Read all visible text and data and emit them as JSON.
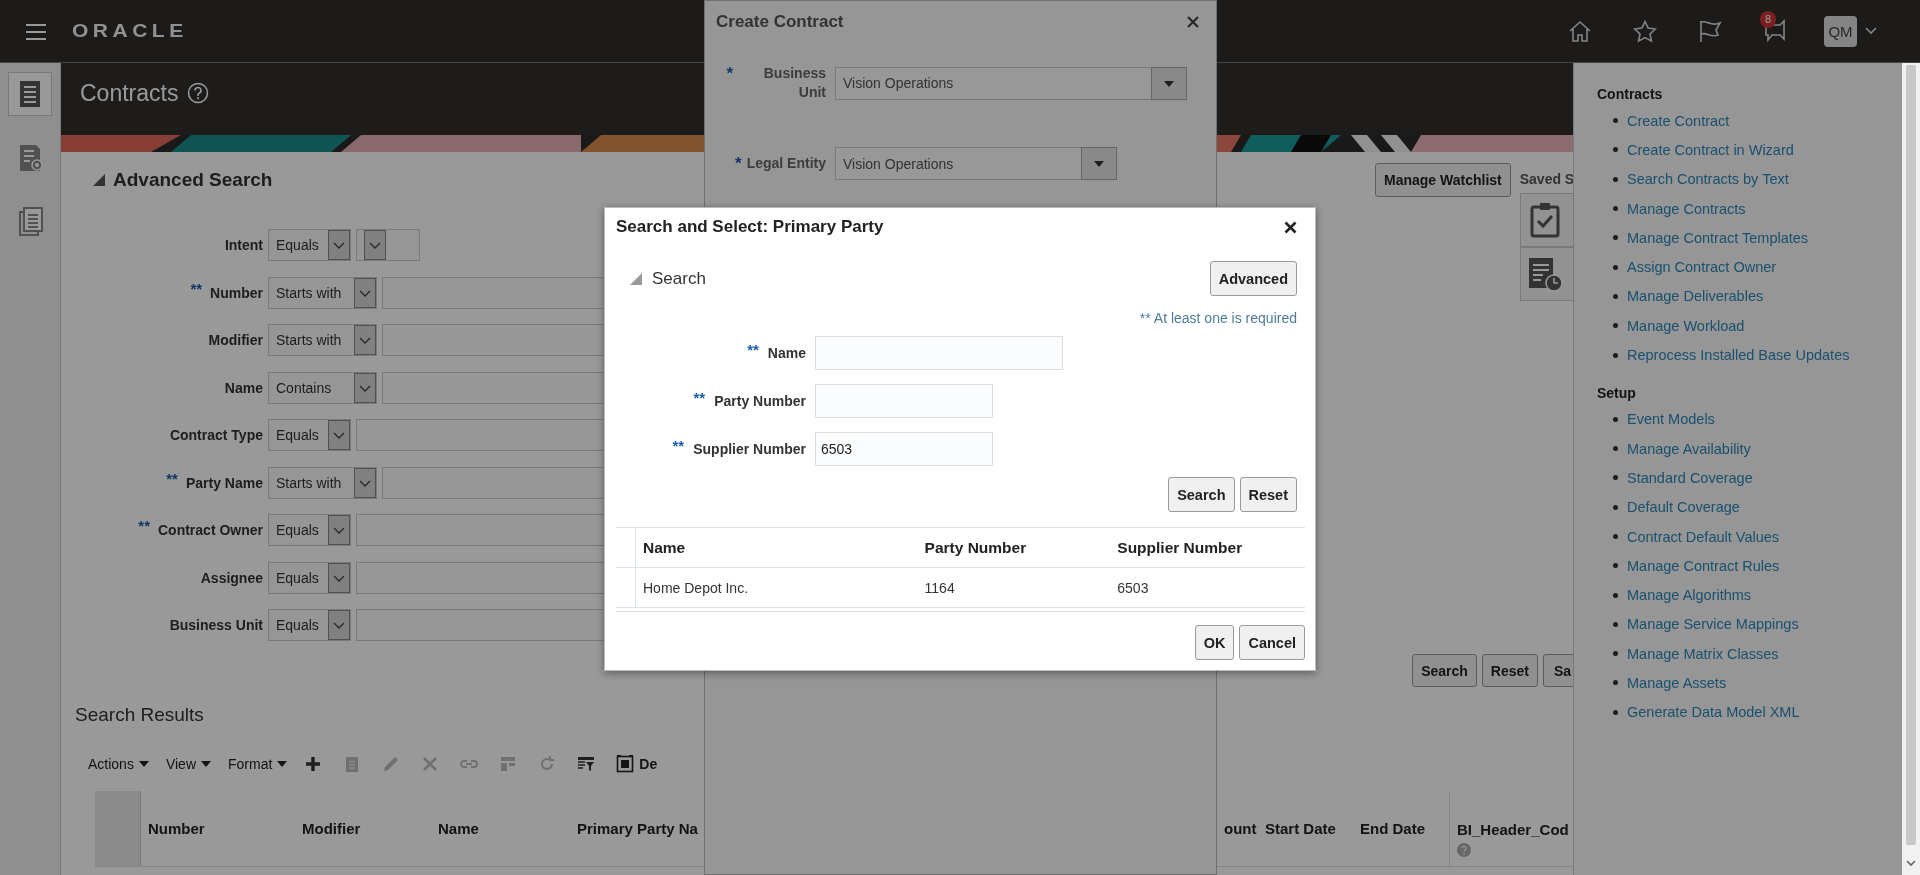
{
  "top_bar": {
    "logo": "ORACLE",
    "notification_count": "8",
    "avatar": "QM"
  },
  "left_nav": [
    {
      "kind": "list",
      "selected": true
    },
    {
      "kind": "search-document",
      "selected": false
    },
    {
      "kind": "document",
      "selected": false
    }
  ],
  "page_header": {
    "title": "Contracts"
  },
  "advanced_search": {
    "title": "Advanced Search",
    "manage_button": "Manage Watchlist",
    "saved_label": "Saved S",
    "fields": [
      {
        "label": "Intent",
        "operator": "Equals",
        "kind": "choice"
      },
      {
        "marker": "**",
        "label": "Number",
        "operator": "Starts with",
        "kind": "text"
      },
      {
        "label": "Modifier",
        "operator": "Starts with",
        "kind": "text"
      },
      {
        "label": "Name",
        "operator": "Contains",
        "kind": "text"
      },
      {
        "label": "Contract Type",
        "operator": "Equals",
        "kind": "text"
      },
      {
        "marker": "**",
        "label": "Party Name",
        "operator": "Starts with",
        "kind": "text"
      },
      {
        "marker": "**",
        "label": "Contract Owner",
        "operator": "Equals",
        "kind": "text"
      },
      {
        "label": "Assignee",
        "operator": "Equals",
        "kind": "text"
      },
      {
        "label": "Business Unit",
        "operator": "Equals",
        "kind": "text"
      }
    ],
    "buttons": [
      "Search",
      "Reset",
      "Sa"
    ]
  },
  "search_results": {
    "title": "Search Results",
    "menus": [
      "Actions",
      "View",
      "Format"
    ],
    "tools": [
      {
        "kind": "add",
        "disabled": false
      },
      {
        "kind": "duplicate",
        "disabled": true
      },
      {
        "kind": "edit",
        "disabled": true
      },
      {
        "kind": "delete",
        "disabled": true
      },
      {
        "kind": "link",
        "disabled": true
      },
      {
        "kind": "columns",
        "disabled": true
      },
      {
        "kind": "refresh",
        "disabled": true
      },
      {
        "kind": "freeze",
        "disabled": false
      },
      {
        "kind": "detach",
        "label": "De",
        "disabled": false
      }
    ],
    "columns": [
      {
        "label": "Number"
      },
      {
        "label": "Modifier"
      },
      {
        "label": "Name"
      },
      {
        "label": "Primary Party Na"
      },
      {
        "label": "ount"
      },
      {
        "label": "Start Date"
      },
      {
        "label": "End Date"
      },
      {
        "label": "BI_Header_Cod",
        "help": true
      }
    ]
  },
  "create_contract": {
    "title": "Create Contract",
    "fields": [
      {
        "marker": "*",
        "label": "Business Unit",
        "value": "Vision Operations"
      },
      {
        "marker": "*",
        "label": "Legal Entity",
        "value": "Vision Operations"
      }
    ]
  },
  "tasks_panel": {
    "sections": [
      {
        "title": "Contracts",
        "links": [
          "Create Contract",
          "Create Contract in Wizard",
          "Search Contracts by Text",
          "Manage Contracts",
          "Manage Contract Templates",
          "Assign Contract Owner",
          "Manage Deliverables",
          "Manage Workload",
          "Reprocess Installed Base Updates"
        ]
      },
      {
        "title": "Setup",
        "links": [
          "Event Models",
          "Manage Availability",
          "Standard Coverage",
          "Default Coverage",
          "Contract Default Values",
          "Manage Contract Rules",
          "Manage Algorithms",
          "Manage Service Mappings",
          "Manage Matrix Classes",
          "Manage Assets",
          "Generate Data Model XML"
        ]
      }
    ]
  },
  "dialog": {
    "title": "Search and Select: Primary Party",
    "section": "Search",
    "advanced_button": "Advanced",
    "required_note": "** At least one is required",
    "fields": [
      {
        "marker": "**",
        "label": "Name"
      },
      {
        "marker": "**",
        "label": "Party Number"
      },
      {
        "marker": "**",
        "label": "Supplier Number",
        "value": "6503"
      }
    ],
    "buttons": [
      "Search",
      "Reset"
    ],
    "table": {
      "columns": [
        "Name",
        "Party Number",
        "Supplier Number"
      ],
      "rows": [
        {
          "cells": [
            "Home Depot Inc.",
            "1164",
            "6503"
          ],
          "selected": false
        }
      ]
    },
    "footer_buttons": [
      "OK",
      "Cancel"
    ]
  }
}
